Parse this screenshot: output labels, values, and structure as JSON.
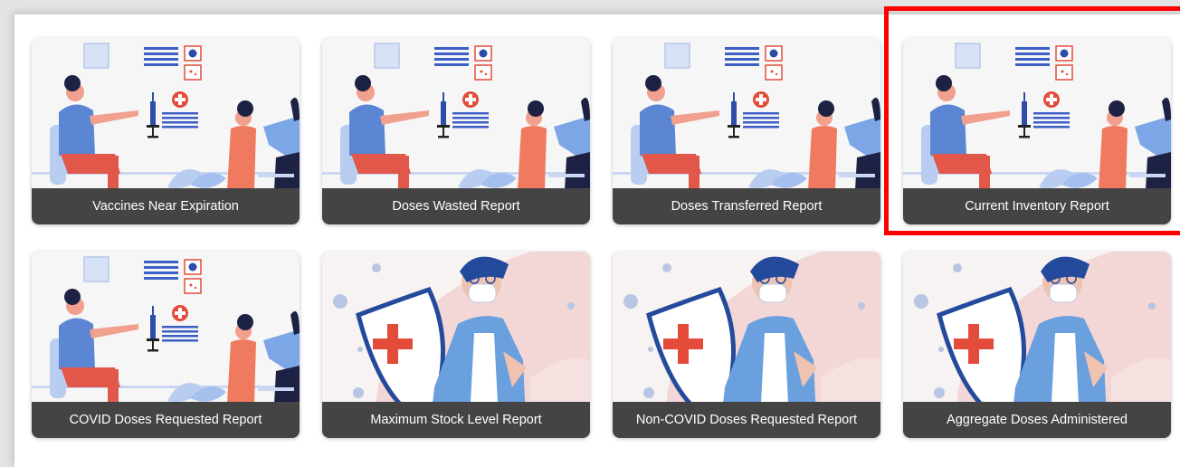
{
  "colors": {
    "caption_bg": "#444444",
    "caption_text": "#ffffff",
    "highlight": "#ff0000",
    "background": "#e3e3e3"
  },
  "tiles": [
    {
      "label": "Vaccines Near Expiration",
      "illustration": "vaccination-illustration"
    },
    {
      "label": "Doses Wasted Report",
      "illustration": "vaccination-illustration"
    },
    {
      "label": "Doses Transferred Report",
      "illustration": "vaccination-illustration"
    },
    {
      "label": "Current Inventory Report",
      "illustration": "vaccination-illustration",
      "highlighted": true
    },
    {
      "label": "COVID Doses Requested Report",
      "illustration": "vaccination-illustration"
    },
    {
      "label": "Maximum Stock Level Report",
      "illustration": "masked-person-shield-illustration"
    },
    {
      "label": "Non-COVID Doses Requested Report",
      "illustration": "masked-person-shield-illustration"
    },
    {
      "label": "Aggregate Doses Administered",
      "illustration": "masked-person-shield-illustration"
    }
  ]
}
